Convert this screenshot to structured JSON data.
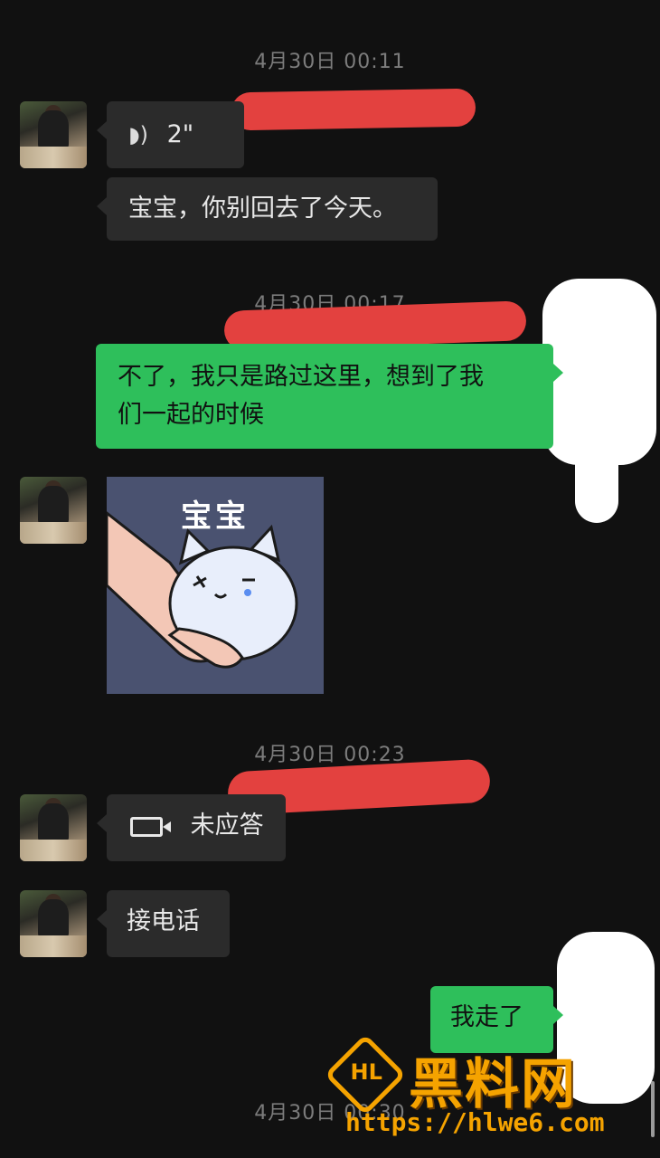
{
  "chat": {
    "timestamps": [
      "4月30日 00:11",
      "4月30日 00:17",
      "4月30日 00:23",
      "4月30日 00:30"
    ],
    "messages": {
      "voice_duration": "2\"",
      "msg_1": "宝宝，你别回去了今天。",
      "msg_2_line1": "不了，我只是路过这里，想到了我",
      "msg_2_line2": "们一起的时候",
      "sticker_text": "宝宝",
      "video_call_status": "未应答",
      "msg_4": "接电话",
      "msg_5": "我走了"
    }
  },
  "watermark": {
    "logo_text": "HL",
    "title": "黑料网",
    "url": "https://hlwe6.com"
  },
  "colors": {
    "background": "#111111",
    "incoming_bubble": "#2b2b2b",
    "outgoing_bubble": "#2ebf5b",
    "redaction": "#e3413f",
    "watermark": "#f5a300"
  }
}
